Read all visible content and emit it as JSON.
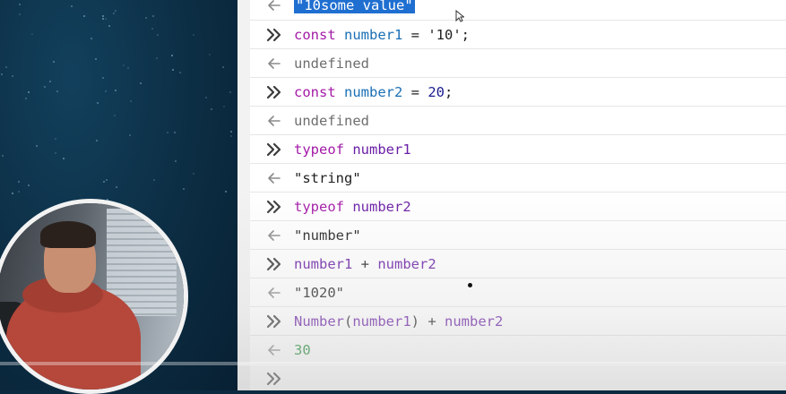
{
  "console": {
    "entries": [
      {
        "type": "output",
        "text": "\"10some value\"",
        "selected": true
      },
      {
        "type": "input",
        "parts": [
          {
            "t": "const",
            "c": "kw"
          },
          {
            "t": " "
          },
          {
            "t": "number1",
            "c": "var-decl"
          },
          {
            "t": " = "
          },
          {
            "t": "'10'",
            "c": "str"
          },
          {
            "t": ";"
          }
        ]
      },
      {
        "type": "output",
        "text": "undefined",
        "cls": "out-undef"
      },
      {
        "type": "input",
        "parts": [
          {
            "t": "const",
            "c": "kw"
          },
          {
            "t": " "
          },
          {
            "t": "number2",
            "c": "var-decl"
          },
          {
            "t": " = "
          },
          {
            "t": "20",
            "c": "num"
          },
          {
            "t": ";"
          }
        ]
      },
      {
        "type": "output",
        "text": "undefined",
        "cls": "out-undef"
      },
      {
        "type": "input",
        "parts": [
          {
            "t": "typeof",
            "c": "kw"
          },
          {
            "t": " "
          },
          {
            "t": "number1",
            "c": "var"
          }
        ]
      },
      {
        "type": "output",
        "text": "\"string\"",
        "cls": "str"
      },
      {
        "type": "input",
        "parts": [
          {
            "t": "typeof",
            "c": "kw"
          },
          {
            "t": " "
          },
          {
            "t": "number2",
            "c": "var"
          }
        ]
      },
      {
        "type": "output",
        "text": "\"number\"",
        "cls": "str"
      },
      {
        "type": "input",
        "parts": [
          {
            "t": "number1",
            "c": "var"
          },
          {
            "t": " + "
          },
          {
            "t": "number2",
            "c": "var"
          }
        ]
      },
      {
        "type": "output",
        "text": "\"1020\"",
        "cls": "str"
      },
      {
        "type": "input",
        "parts": [
          {
            "t": "Number",
            "c": "var"
          },
          {
            "t": "("
          },
          {
            "t": "number1",
            "c": "var"
          },
          {
            "t": ") + "
          },
          {
            "t": "number2",
            "c": "var"
          }
        ]
      },
      {
        "type": "output",
        "text": "30",
        "cls": "out-num"
      }
    ],
    "prompt_glyph": "»",
    "result_glyph": "←"
  },
  "colors": {
    "keyword": "#a31ba8",
    "declared_variable": "#1a6fb5",
    "variable": "#6a1ea6",
    "number_result": "#1a8a2f",
    "selection": "#1f6fd1",
    "background_left": "#0c2a3f"
  },
  "icons": {
    "prompt": "double-chevron-right-icon",
    "result": "arrow-left-icon"
  }
}
